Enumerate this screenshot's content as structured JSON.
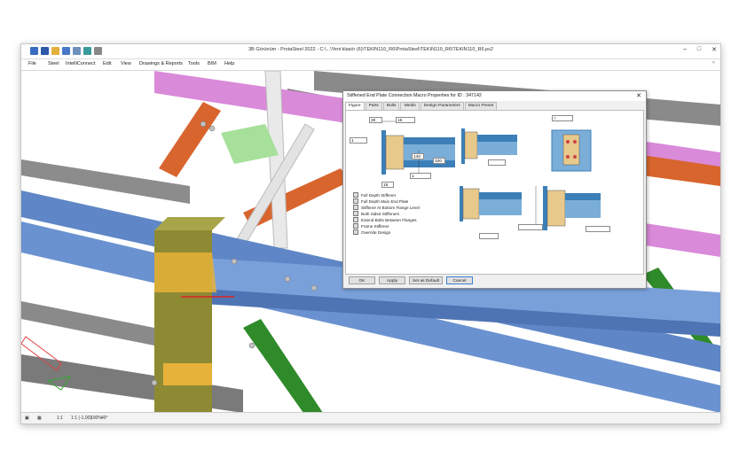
{
  "window": {
    "title": "3B Görünüm - ProtaSteel 2022 - C:\\...\\Yeni klasör (6)\\TEKIN110_R6\\ProtaSteel\\TEKIN110_R6\\TEKIN110_R6.ps2",
    "minimize": "–",
    "maximize": "□",
    "close": "✕"
  },
  "menu": [
    "File",
    "Steel",
    "IntelliConnect",
    "Edit",
    "View",
    "Drawings & Reports",
    "Tools",
    "BIM",
    "Help"
  ],
  "dialog": {
    "title": "Stiffened End Plate Connection Macro Properties for ID : 347142",
    "close": "✕",
    "tabs": [
      "Figure",
      "Parts",
      "Bolts",
      "Welds",
      "Design Parameters",
      "Macro Preset"
    ],
    "active_tab": "Figure",
    "fields": {
      "top_left": "30",
      "top_right": "15",
      "left": "1",
      "mid": "140",
      "right": "100",
      "small": "1",
      "bottom": "15",
      "fig4_top": "0"
    },
    "options": [
      "Full Depth Stiffener",
      "Full Depth Main End Plate",
      "Stiffener At Bottom Flange Level",
      "Both Sided Stiffeners",
      "Extend Bolts Between Flanges",
      "Frame Stiffener",
      "Override Design"
    ],
    "buttons": {
      "ok": "OK",
      "apply": "Apply",
      "default": "Set as Default",
      "cancel": "Cancel"
    }
  },
  "status": {
    "left": "1:1",
    "mid": "1:1 (-1,00)",
    "right": "100%",
    "end": "40°"
  },
  "colors": {
    "beam_blue": "#5f86c6",
    "beam_grey": "#7a7a7a",
    "beam_pink": "#d98ad9",
    "beam_orange": "#d8652e",
    "column_olive": "#8e8a34",
    "plate_yellow": "#e6b23a",
    "brace_green": "#2f8a2a",
    "part_tan": "#e8c98c",
    "stiff_blue": "#3c7fb8"
  }
}
